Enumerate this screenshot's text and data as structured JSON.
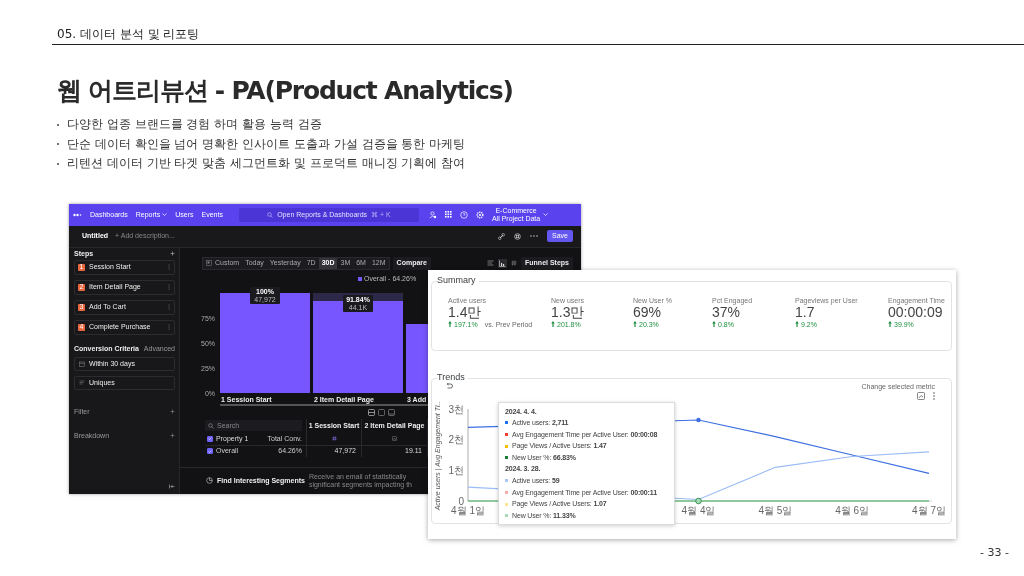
{
  "slide": {
    "section": "05. 데이터 분석 및 리포팅",
    "title": "웹 어트리뷰션 - PA(Product Analytics)",
    "bullets": [
      "다양한 업종 브랜드를 경험 하며 활용 능력 검증",
      "단순 데이터 확인을 넘어 명확한 인사이트 도출과 가설 검증을 통한 마케팅",
      "리텐션 데이터 기반 타겟 맞춤 세그먼트화 및 프로덕트 매니징 기획에 참여"
    ],
    "page_number": "- 33 -"
  },
  "funnel_app": {
    "nav": [
      {
        "label": "Dashboards",
        "dropdown": false
      },
      {
        "label": "Reports",
        "dropdown": true
      },
      {
        "label": "Users",
        "dropdown": false
      },
      {
        "label": "Events",
        "dropdown": false
      }
    ],
    "search": {
      "placeholder": "Open Reports & Dashboards",
      "shortcut": "⌘ + K"
    },
    "project": {
      "name": "E-Commerce",
      "scope": "All Project Data"
    },
    "report": {
      "title": "Untitled",
      "description_placeholder": "+ Add description...",
      "save": "Save"
    },
    "steps_heading": "Steps",
    "steps": [
      {
        "number": "1",
        "name": "Session Start"
      },
      {
        "number": "2",
        "name": "Item Detail Page"
      },
      {
        "number": "3",
        "name": "Add To Cart"
      },
      {
        "number": "4",
        "name": "Complete Purchase"
      }
    ],
    "conversion": {
      "heading": "Conversion Criteria",
      "mode": "Advanced",
      "window": "Within 30 days",
      "counting": "Uniques"
    },
    "sections": [
      "Filter",
      "Breakdown"
    ],
    "date_ranges": [
      {
        "label": "Custom",
        "selected": false
      },
      {
        "label": "Today",
        "selected": false
      },
      {
        "label": "Yesterday",
        "selected": false
      },
      {
        "label": "7D",
        "selected": false
      },
      {
        "label": "30D",
        "selected": true
      },
      {
        "label": "3M",
        "selected": false
      },
      {
        "label": "6M",
        "selected": false
      },
      {
        "label": "12M",
        "selected": false
      }
    ],
    "compare": "Compare",
    "view_mode": "Funnel Steps",
    "legend": {
      "label": "Overall - 64.26%",
      "color": "#7856ff"
    },
    "chart_data": {
      "type": "bar",
      "stacked": true,
      "categories": [
        "1 Session Start",
        "2 Item Detail Page",
        "3 Add"
      ],
      "ylim": [
        0,
        100
      ],
      "yticks": [
        {
          "value": 0,
          "label": "0%"
        },
        {
          "value": 25,
          "label": "25%"
        },
        {
          "value": 50,
          "label": "50%"
        },
        {
          "value": 75,
          "label": "75%"
        }
      ],
      "series": [
        {
          "color": "#7856ff",
          "values": [
            100,
            92,
            69
          ]
        },
        {
          "color": "#2c2848",
          "values": [
            0,
            8,
            null
          ]
        }
      ]
    },
    "bar_labels": [
      {
        "percent": "100%",
        "count": "47,972"
      },
      {
        "percent": "91.84%",
        "count": "44.1K"
      }
    ],
    "table": {
      "search_placeholder": "Search",
      "columns": [
        "1 Session Start",
        "2 Item Detail Page"
      ],
      "property_header": "Property 1",
      "property_checked": true,
      "total_header": "Total Conv.",
      "rows": [
        {
          "checked": true,
          "name": "Overall",
          "total": "64.26%",
          "cells": [
            "47,972",
            "19.11"
          ]
        }
      ]
    },
    "footer": {
      "title": "Find Interesting Segments",
      "text": "Receive an email of statistically significant segments impacting th"
    }
  },
  "analytics_report": {
    "summary": {
      "title": "Summary",
      "metrics": [
        {
          "label": "Active users",
          "value": "1.4만",
          "change": "197.1%",
          "note": "vs. Prev Period"
        },
        {
          "label": "New users",
          "value": "1.3만",
          "change": "201.8%"
        },
        {
          "label": "New User %",
          "value": "69%",
          "change": "20.3%"
        },
        {
          "label": "Pct Engaged",
          "value": "37%",
          "change": "0.8%"
        },
        {
          "label": "Pageviews per User",
          "value": "1.7",
          "change": "9.2%"
        },
        {
          "label": "Engagement Time",
          "value": "00:00:09",
          "change": "39.9%"
        }
      ]
    },
    "trends": {
      "title": "Trends",
      "menu_hint": "Change selected metric",
      "chart_data": {
        "type": "line",
        "ylabel": "Active users | Avg Engagement Ti...",
        "categories": [
          "4월 1일",
          null,
          null,
          "4월 4일",
          "4월 5일",
          "4월 6일",
          "4월 7일"
        ],
        "ylim": [
          0,
          3
        ],
        "yticks": [
          {
            "value": 0,
            "label": "0"
          },
          {
            "value": 1,
            "label": "1천"
          },
          {
            "value": 2,
            "label": "2천"
          },
          {
            "value": 3,
            "label": "3천"
          }
        ],
        "series": [
          {
            "color": "#3d6fe0",
            "values": [
              2.4,
              null,
              null,
              2.64,
              2.1,
              1.5,
              0.9
            ]
          },
          {
            "color": "#9bbcf7",
            "values": [
              0.45,
              null,
              null,
              0.05,
              1.1,
              1.45,
              1.6
            ]
          },
          {
            "color": "#34a853",
            "values": [
              0,
              null,
              null,
              0,
              0,
              0,
              0
            ]
          }
        ]
      }
    },
    "tooltip": {
      "groups": [
        {
          "date": "2024. 4. 4.",
          "rows": [
            {
              "text": "Active users: **2,711**",
              "color": "#1a73e8"
            },
            {
              "text": "Avg Engagement Time per Active User: **00:00:08**",
              "color": "#ea4335"
            },
            {
              "text": "Page Views / Active Users: **1.47**",
              "color": "#fbbc04"
            },
            {
              "text": "New User %: **66.83%**",
              "color": "#188038"
            }
          ]
        },
        {
          "date": "2024. 3. 28.",
          "rows": [
            {
              "text": "Active users: **59**",
              "color": "#a8c7fa"
            },
            {
              "text": "Avg Engagement Time per Active User: **00:00:11**",
              "color": "#f6aea9"
            },
            {
              "text": "Page Views / Active Users: **1.07**",
              "color": "#fde293"
            },
            {
              "text": "New User %: **11.33%**",
              "color": "#a8dab5"
            }
          ]
        }
      ]
    }
  }
}
